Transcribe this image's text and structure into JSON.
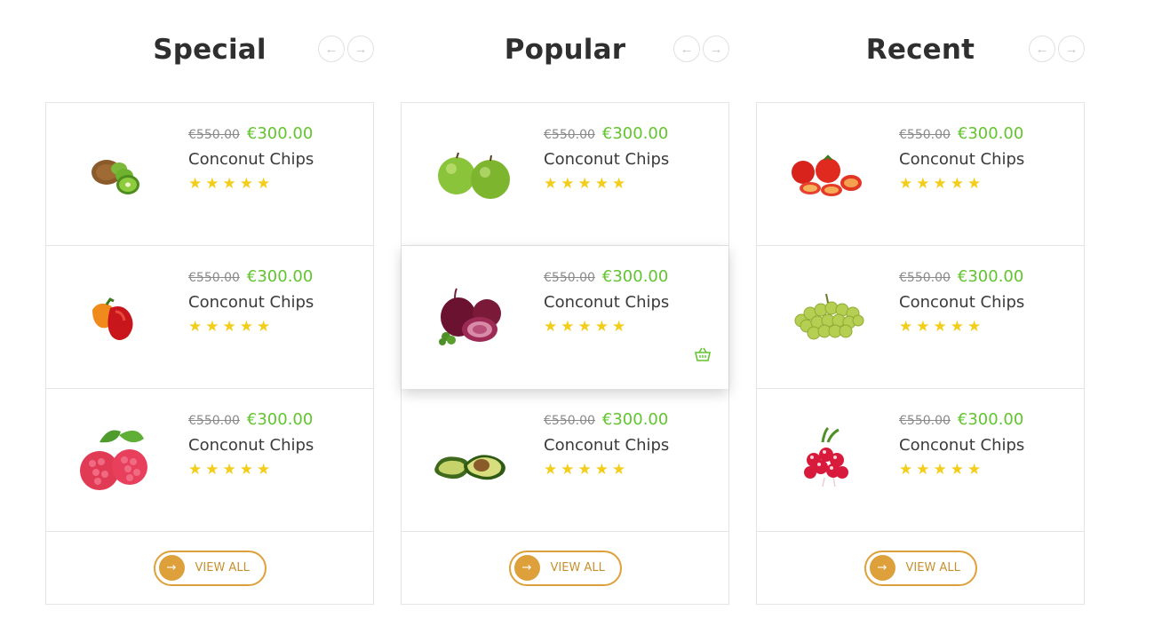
{
  "colors": {
    "accent": "#dda03a",
    "price": "#62c42f",
    "star": "#f3cd1a",
    "border": "#e5e5e5"
  },
  "nav": {
    "prev": "←",
    "next": "→"
  },
  "columns": [
    {
      "title": "Special",
      "view_all": "VIEW ALL",
      "items": [
        {
          "image": "kiwi",
          "old_price": "€550.00",
          "price": "€300.00",
          "name": "Conconut Chips",
          "rating": 5
        },
        {
          "image": "bell-peppers",
          "old_price": "€550.00",
          "price": "€300.00",
          "name": "Conconut Chips",
          "rating": 5
        },
        {
          "image": "raspberries",
          "old_price": "€550.00",
          "price": "€300.00",
          "name": "Conconut Chips",
          "rating": 5
        }
      ]
    },
    {
      "title": "Popular",
      "view_all": "VIEW ALL",
      "items": [
        {
          "image": "green-apples",
          "old_price": "€550.00",
          "price": "€300.00",
          "name": "Conconut Chips",
          "rating": 5
        },
        {
          "image": "red-onions",
          "old_price": "€550.00",
          "price": "€300.00",
          "name": "Conconut Chips",
          "rating": 5,
          "hover": true
        },
        {
          "image": "avocado",
          "old_price": "€550.00",
          "price": "€300.00",
          "name": "Conconut Chips",
          "rating": 5
        }
      ]
    },
    {
      "title": "Recent",
      "view_all": "VIEW ALL",
      "items": [
        {
          "image": "tomatoes",
          "old_price": "€550.00",
          "price": "€300.00",
          "name": "Conconut Chips",
          "rating": 5
        },
        {
          "image": "green-grapes",
          "old_price": "€550.00",
          "price": "€300.00",
          "name": "Conconut Chips",
          "rating": 5
        },
        {
          "image": "radishes",
          "old_price": "€550.00",
          "price": "€300.00",
          "name": "Conconut Chips",
          "rating": 5
        }
      ]
    }
  ]
}
